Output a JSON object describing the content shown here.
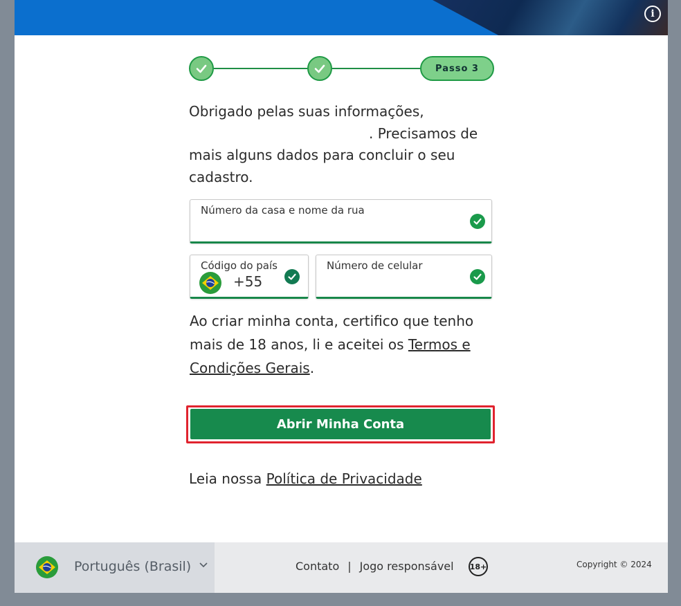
{
  "stepper": {
    "current_step_label": "Passo 3"
  },
  "intro": {
    "line1": "Obrigado pelas suas informações,",
    "line2": ". Precisamos de mais alguns dados para concluir o seu cadastro."
  },
  "fields": {
    "address_label": "Número da casa e nome da rua",
    "country_code_label": "Código do país",
    "country_code_value": "+55",
    "phone_label": "Número de celular"
  },
  "terms": {
    "text": "Ao criar minha conta, certifico que tenho mais de 18 anos, li e aceitei os ",
    "link": "Termos e Condições Gerais",
    "end": "."
  },
  "cta_label": "Abrir Minha Conta",
  "privacy": {
    "prefix": "Leia nossa ",
    "link": "Política de Privacidade"
  },
  "footer": {
    "language": "Português (Brasil)",
    "contact": "Contato",
    "separator": "|",
    "responsible": "Jogo responsável",
    "age_badge": "18+",
    "copyright": "Copyright © 2024"
  },
  "colors": {
    "brand_blue": "#0b6fce",
    "success_green": "#178a4d",
    "highlight_red": "#e0232e"
  },
  "icons": [
    "info-icon",
    "check-icon",
    "brazil-flag-icon",
    "chevron-down-icon",
    "age-18-icon"
  ]
}
